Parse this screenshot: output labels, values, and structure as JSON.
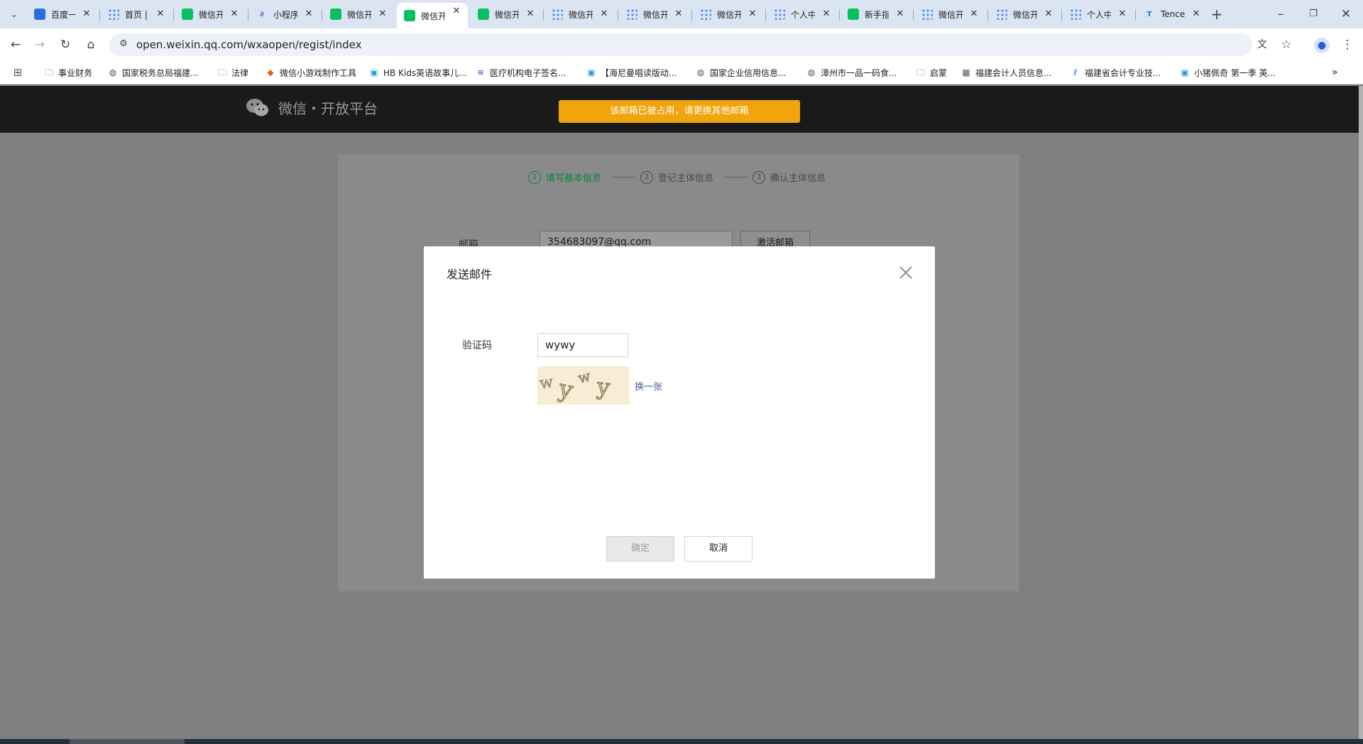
{
  "browser": {
    "tabs": [
      {
        "title": "百度一",
        "icon": "baidu-icon"
      },
      {
        "title": "首页 |",
        "icon": "grid-app-icon"
      },
      {
        "title": "微信开",
        "icon": "wechat-icon"
      },
      {
        "title": "小程序",
        "icon": "link-icon"
      },
      {
        "title": "微信开",
        "icon": "wechat-icon"
      },
      {
        "title": "微信开",
        "icon": "wechat-icon",
        "active": true
      },
      {
        "title": "微信开",
        "icon": "wechat-icon"
      },
      {
        "title": "微信开",
        "icon": "grid-app-icon"
      },
      {
        "title": "微信开",
        "icon": "grid-app-icon"
      },
      {
        "title": "微信开",
        "icon": "grid-app-icon"
      },
      {
        "title": "个人中",
        "icon": "grid-app-icon"
      },
      {
        "title": "新手指",
        "icon": "wechat-icon"
      },
      {
        "title": "微信开",
        "icon": "grid-app-icon"
      },
      {
        "title": "微信开",
        "icon": "grid-app-icon"
      },
      {
        "title": "个人中",
        "icon": "grid-app-icon"
      },
      {
        "title": "Tence",
        "icon": "tencent-icon"
      }
    ],
    "url": "open.weixin.qq.com/wxaopen/regist/index",
    "bookmarks": [
      {
        "label": "事业财务",
        "icon": "folder-icon"
      },
      {
        "label": "国家税务总局福建...",
        "icon": "globe-icon"
      },
      {
        "label": "法律",
        "icon": "folder-icon"
      },
      {
        "label": "微信小游戏制作工具",
        "icon": "game-tool-icon"
      },
      {
        "label": "HB Kids英语故事儿...",
        "icon": "bilibili-icon"
      },
      {
        "label": "医疗机构电子签名...",
        "icon": "fm-icon"
      },
      {
        "label": "【海尼曼唱读版动...",
        "icon": "bilibili-icon"
      },
      {
        "label": "国家企业信用信息...",
        "icon": "globe-icon"
      },
      {
        "label": "漳州市一品一码食...",
        "icon": "globe-icon"
      },
      {
        "label": "启蒙",
        "icon": "folder-icon"
      },
      {
        "label": "福建会计人员信息...",
        "icon": "chart-icon"
      },
      {
        "label": "福建省会计专业技...",
        "icon": "lx-icon"
      },
      {
        "label": "小猪佩奇 第一季 英...",
        "icon": "bilibili-icon"
      }
    ]
  },
  "header": {
    "logo_text": "微信・开放平台",
    "toast": "该邮箱已被占用，请更换其他邮箱"
  },
  "steps": [
    {
      "num": "1",
      "label": "填写基本信息"
    },
    {
      "num": "2",
      "label": "登记主体信息"
    },
    {
      "num": "3",
      "label": "确认主体信息"
    }
  ],
  "form": {
    "email_label": "邮箱",
    "email_value": "354683097@qq.com",
    "activate_button": "激活邮箱"
  },
  "modal": {
    "title": "发送邮件",
    "captcha_label": "验证码",
    "captcha_value": "wywy",
    "refresh_link": "换一张",
    "ok_button": "确定",
    "cancel_button": "取消"
  },
  "colors": {
    "header_bg": "#1a1a1a",
    "toast_bg": "#f0a40e",
    "active_step": "#07c160",
    "link": "#3c5a9a"
  }
}
